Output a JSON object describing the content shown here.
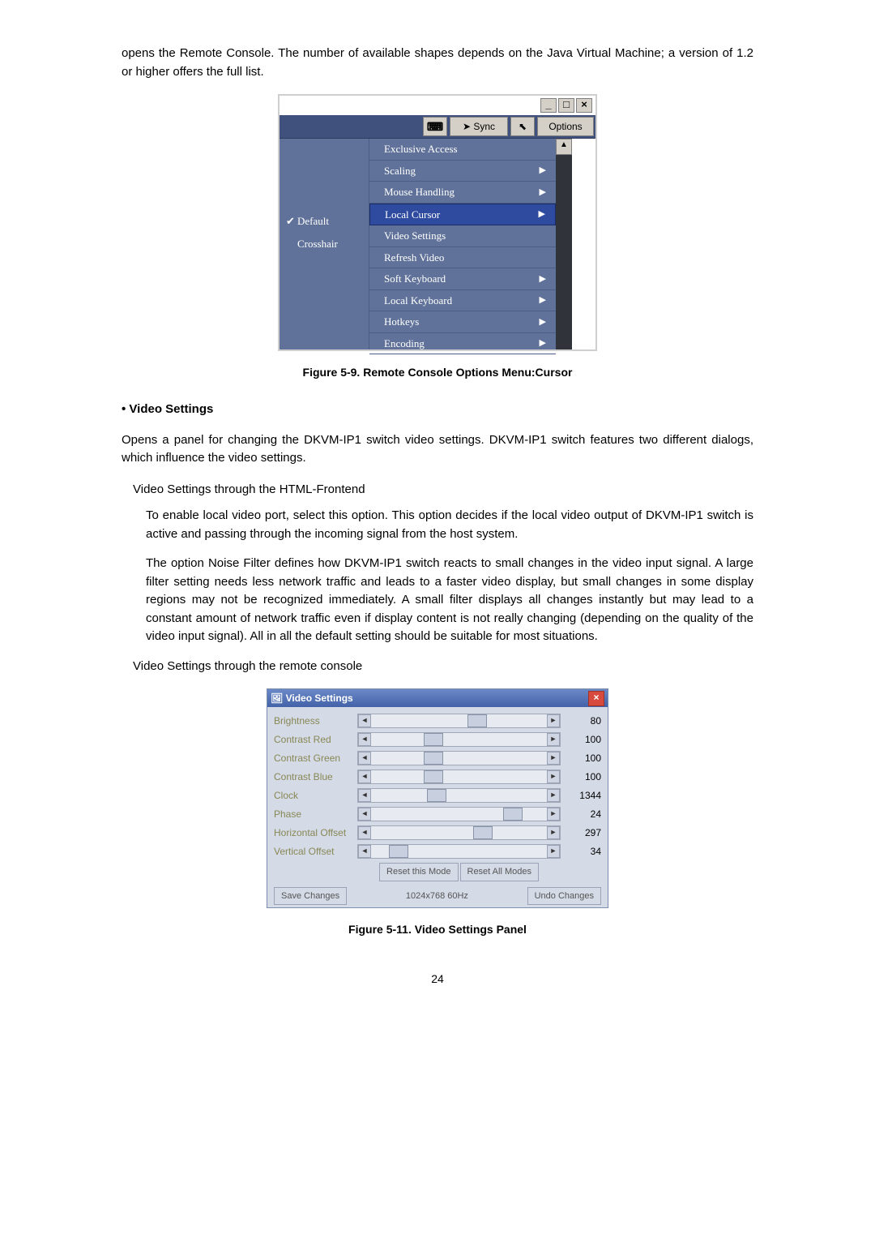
{
  "top_text": "opens the Remote Console. The number of available shapes depends on the Java Virtual Machine; a version of 1.2 or higher offers the full list.",
  "fig1_caption": "Figure 5-9. Remote Console Options Menu:Cursor",
  "section_title": "• Video Settings",
  "section_text": "Opens a panel for changing the DKVM-IP1 switch video settings. DKVM-IP1 switch features two different dialogs, which influence the video settings.",
  "sub1_heading": "Video Settings through the HTML-Frontend",
  "sub1_p1": "To enable local video port, select this option. This option decides if the local video output of DKVM-IP1 switch is active and passing through the incoming signal from the host system.",
  "sub1_p2": "The option Noise Filter defines how DKVM-IP1 switch reacts to small changes in the video input signal. A large filter setting needs less network traffic and leads to a faster video display, but small changes in some display regions may not be recognized immediately. A small filter displays all changes instantly but may lead to a constant amount of network traffic even if display content is not really changing (depending on the quality of the video input signal). All in all the default setting should be suitable for most situations.",
  "sub2_heading": "Video Settings through the remote console",
  "fig2_caption": "Figure 5-11. Video Settings Panel",
  "page_number": "24",
  "fig1": {
    "toolbar_sync": "Sync",
    "toolbar_options": "Options",
    "submenu_default": "Default",
    "submenu_crosshair": "Crosshair",
    "menu_items": {
      "exclusive": "Exclusive Access",
      "scaling": "Scaling",
      "mouse": "Mouse Handling",
      "localcursor": "Local Cursor",
      "videosettings": "Video Settings",
      "refresh": "Refresh Video",
      "softkb": "Soft Keyboard",
      "localkb": "Local Keyboard",
      "hotkeys": "Hotkeys",
      "encoding": "Encoding"
    }
  },
  "fig2": {
    "title": "Video Settings",
    "rows": {
      "brightness": {
        "label": "Brightness",
        "value": "80",
        "pos": "55%"
      },
      "cred": {
        "label": "Contrast Red",
        "value": "100",
        "pos": "30%"
      },
      "cgreen": {
        "label": "Contrast Green",
        "value": "100",
        "pos": "30%"
      },
      "cblue": {
        "label": "Contrast Blue",
        "value": "100",
        "pos": "30%"
      },
      "clock": {
        "label": "Clock",
        "value": "1344",
        "pos": "32%"
      },
      "phase": {
        "label": "Phase",
        "value": "24",
        "pos": "75%"
      },
      "hoffset": {
        "label": "Horizontal Offset",
        "value": "297",
        "pos": "58%"
      },
      "voffset": {
        "label": "Vertical Offset",
        "value": "34",
        "pos": "10%"
      }
    },
    "btn_reset_mode": "Reset this Mode",
    "btn_reset_all": "Reset All Modes",
    "btn_save": "Save Changes",
    "resolution": "1024x768 60Hz",
    "btn_undo": "Undo Changes"
  }
}
